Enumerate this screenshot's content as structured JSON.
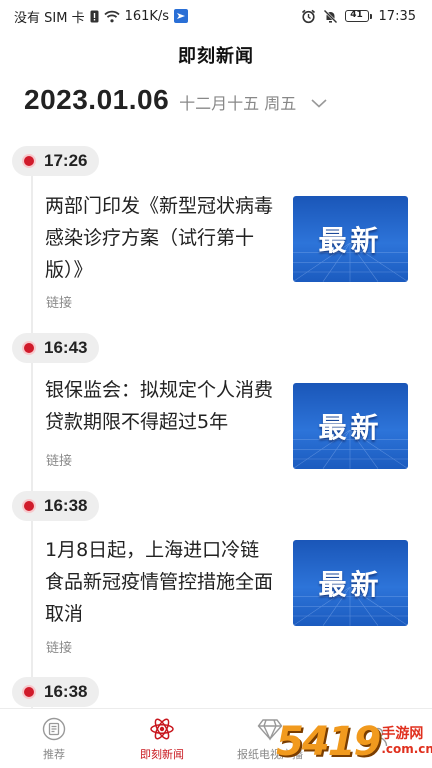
{
  "status_bar": {
    "sim_text": "没有 SIM 卡",
    "speed": "161K/s",
    "battery": "41",
    "time": "17:35",
    "icons": [
      "sim-alert-icon",
      "wifi-icon",
      "location-arrow-icon",
      "alarm-icon",
      "mute-bell-icon",
      "battery-icon"
    ]
  },
  "header": {
    "title": "即刻新闻"
  },
  "date_bar": {
    "date": "2023.01.06",
    "lunar": "十二月十五 周五"
  },
  "news_items": [
    {
      "time": "17:26",
      "headline": "两部门印发《新型冠状病毒感染诊疗方案（试行第十版）》",
      "link": "链接",
      "thumb_text": "最新"
    },
    {
      "time": "16:43",
      "headline": "银保监会：拟规定个人消费贷款期限不得超过5年",
      "link": "链接",
      "thumb_text": "最新"
    },
    {
      "time": "16:38",
      "headline": "1月8日起，上海进口冷链食品新冠疫情管控措施全面取消",
      "link": "链接",
      "thumb_text": "最新"
    },
    {
      "time": "16:38"
    }
  ],
  "bottom_nav": {
    "tabs": [
      {
        "label": "推荐",
        "icon": "recommend-icon",
        "active": false
      },
      {
        "label": "即刻新闻",
        "icon": "atom-icon",
        "active": true
      },
      {
        "label": "报纸电视广播",
        "icon": "diamond-icon",
        "active": false
      },
      {
        "label": "",
        "icon": "profile-icon",
        "active": false
      }
    ]
  },
  "watermark": {
    "digits": "5419",
    "cn": "手游网",
    "domain": ".com.cn"
  },
  "colors": {
    "accent": "#d01b2b",
    "thumb_blue": "#1f5fc4",
    "watermark_orange": "#f19a1e"
  }
}
